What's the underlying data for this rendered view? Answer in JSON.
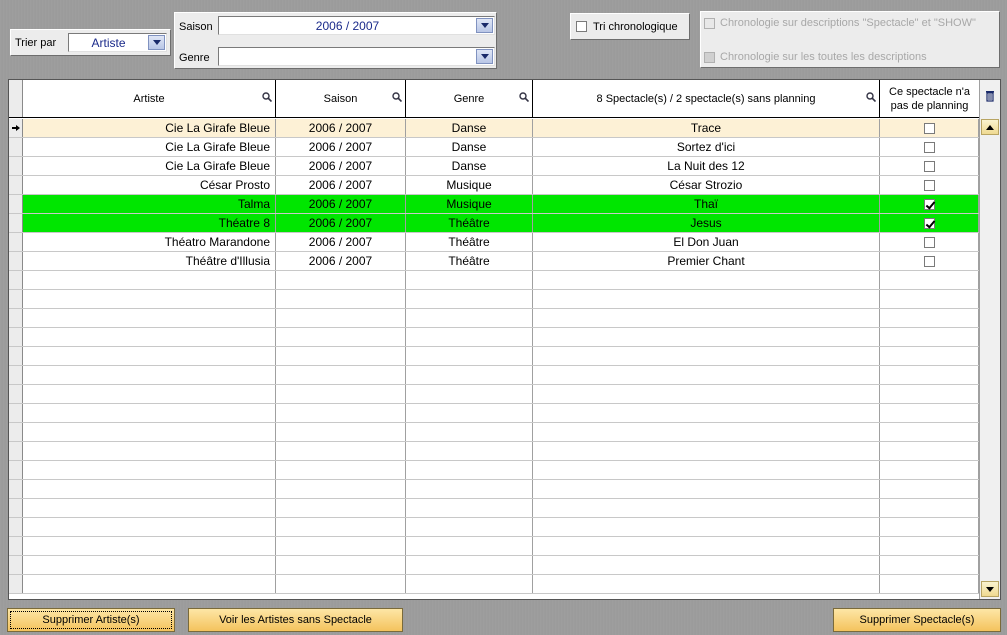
{
  "sort": {
    "label": "Trier par",
    "value": "Artiste"
  },
  "filters": {
    "season_label": "Saison",
    "season_value": "2006 / 2007",
    "genre_label": "Genre",
    "genre_value": ""
  },
  "options": {
    "tri_chrono_label": "Tri chronologique",
    "tri_chrono_checked": false,
    "chrono_spectacle_label": "Chronologie sur descriptions \"Spectacle\" et \"SHOW\"",
    "chrono_all_label": "Chronologie sur les toutes les descriptions"
  },
  "table": {
    "columns": [
      "Artiste",
      "Saison",
      "Genre",
      "8 Spectacle(s) / 2 spectacle(s) sans planning",
      "Ce spectacle n'a pas de planning"
    ],
    "rows": [
      {
        "artiste": "Cie La Girafe Bleue",
        "saison": "2006 / 2007",
        "genre": "Danse",
        "spectacle": "Trace",
        "no_planning": false
      },
      {
        "artiste": "Cie La Girafe Bleue",
        "saison": "2006 / 2007",
        "genre": "Danse",
        "spectacle": "Sortez d'ici",
        "no_planning": false
      },
      {
        "artiste": "Cie La Girafe Bleue",
        "saison": "2006 / 2007",
        "genre": "Danse",
        "spectacle": "La Nuit des 12",
        "no_planning": false
      },
      {
        "artiste": "César Prosto",
        "saison": "2006 / 2007",
        "genre": "Musique",
        "spectacle": "César Strozio",
        "no_planning": false
      },
      {
        "artiste": "Talma",
        "saison": "2006 / 2007",
        "genre": "Musique",
        "spectacle": "Thaï",
        "no_planning": true
      },
      {
        "artiste": "Théatre 8",
        "saison": "2006 / 2007",
        "genre": "Théâtre",
        "spectacle": "Jesus",
        "no_planning": true
      },
      {
        "artiste": "Théatro Marandone",
        "saison": "2006 / 2007",
        "genre": "Théâtre",
        "spectacle": "El Don  Juan",
        "no_planning": false
      },
      {
        "artiste": "Théâtre d'Illusia",
        "saison": "2006 / 2007",
        "genre": "Théâtre",
        "spectacle": "Premier Chant",
        "no_planning": false
      }
    ],
    "selected_row": 0,
    "highlight_color": "#00e600",
    "selected_color": "#fdf1d6"
  },
  "buttons": {
    "delete_artist": "Supprimer Artiste(s)",
    "artists_no_show": "Voir les Artistes sans Spectacle",
    "delete_show": "Supprimer Spectacle(s)"
  },
  "icons": {
    "column_search": "magnifier-icon",
    "row_pointer": "arrow-right-icon",
    "delete_column": "trash-icon"
  }
}
